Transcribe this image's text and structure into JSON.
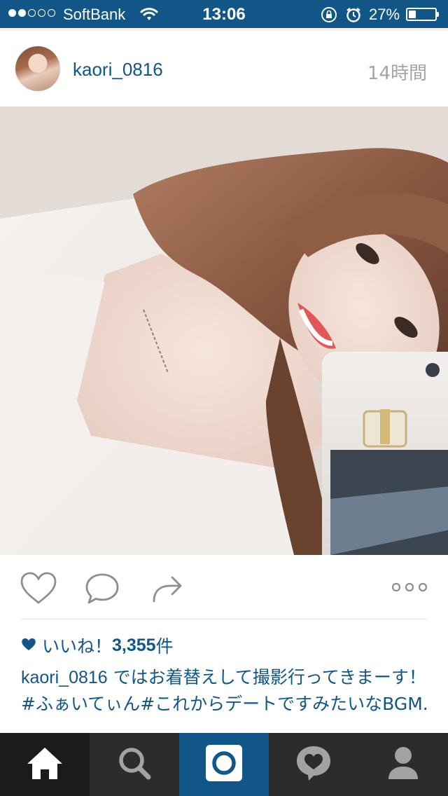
{
  "status_bar": {
    "carrier": "SoftBank",
    "time": "13:06",
    "battery_percent_text": "27%",
    "battery_level": 0.27,
    "signal_filled": 2,
    "signal_total": 5,
    "icons": [
      "wifi-icon",
      "rotation-lock-icon",
      "alarm-icon",
      "battery-icon"
    ]
  },
  "post": {
    "username": "kaori_0816",
    "time_ago": "14時間",
    "likes_label": "いいね！",
    "likes_count": "3,355",
    "likes_unit": "件",
    "caption_user": "kaori_0816",
    "caption_text": " ではお着替えして撮影行ってきまーす！#ふぁいてぃん#これからデートですみたいなBGM."
  },
  "actions": {
    "icons": [
      "heart-icon",
      "comment-icon",
      "share-icon",
      "more-icon"
    ]
  },
  "tab_bar": {
    "tabs": [
      "home",
      "search",
      "camera",
      "activity",
      "profile"
    ],
    "active": "home"
  },
  "colors": {
    "brand_blue": "#125688",
    "tab_bar_bg": "#2c2c2c",
    "timestamp_gray": "#a5a5a5"
  }
}
